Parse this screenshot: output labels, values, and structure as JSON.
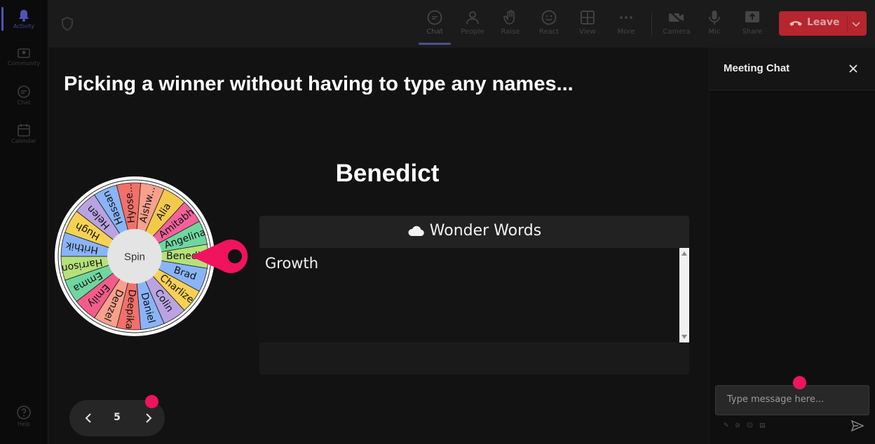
{
  "rail": {
    "items": [
      {
        "label": "Activity",
        "icon": "bell-icon"
      },
      {
        "label": "Community",
        "icon": "community-icon"
      },
      {
        "label": "Chat",
        "icon": "chat-icon"
      },
      {
        "label": "Calendar",
        "icon": "calendar-icon"
      }
    ],
    "help_label": "Help"
  },
  "toolbar": {
    "buttons": [
      {
        "label": "Chat",
        "icon": "chat-icon"
      },
      {
        "label": "People",
        "icon": "people-icon"
      },
      {
        "label": "Raise",
        "icon": "hand-icon"
      },
      {
        "label": "React",
        "icon": "smiley-icon"
      },
      {
        "label": "View",
        "icon": "grid-icon"
      },
      {
        "label": "More",
        "icon": "ellipsis-icon"
      },
      {
        "label": "Camera",
        "icon": "camera-off-icon"
      },
      {
        "label": "Mic",
        "icon": "mic-icon"
      },
      {
        "label": "Share",
        "icon": "share-icon"
      }
    ],
    "leave_label": "Leave"
  },
  "stage": {
    "title": "Picking a winner without having to type any names...",
    "winner": "Benedict",
    "spin_label": "Spin",
    "wheel_names": [
      "Alia",
      "Amitabh",
      "Angelina",
      "Benedict",
      "Brad",
      "Charlize",
      "Colin",
      "Daniel",
      "Deepika",
      "Denzel",
      "Emily",
      "Emma",
      "Harrison",
      "Hrithik",
      "Hugh",
      "Helen",
      "Hassan",
      "Hyose...",
      "Aishw..."
    ],
    "wheel_colors": [
      "#f2c94c",
      "#f4609a",
      "#6fd6a0",
      "#b6e07a",
      "#8ab4f8",
      "#f7d154",
      "#b9a3e0",
      "#8ab4f8",
      "#f2706a",
      "#f7a08c",
      "#f25c8a",
      "#6fd6a0",
      "#b6e07a",
      "#8ab4f8",
      "#f7d154",
      "#b9a3e0",
      "#8ab4f8",
      "#f2706a",
      "#f7a08c"
    ]
  },
  "wonder_words": {
    "title": "Wonder Words",
    "content": "Growth"
  },
  "pager": {
    "page": "5"
  },
  "chat": {
    "title": "Meeting Chat",
    "input_placeholder": "Type message here...",
    "tools": "✎ ⊘ ☺ ▤"
  },
  "colors": {
    "leave": "#b5262f",
    "accent": "#4f55b8",
    "pointer": "#f0135e"
  }
}
